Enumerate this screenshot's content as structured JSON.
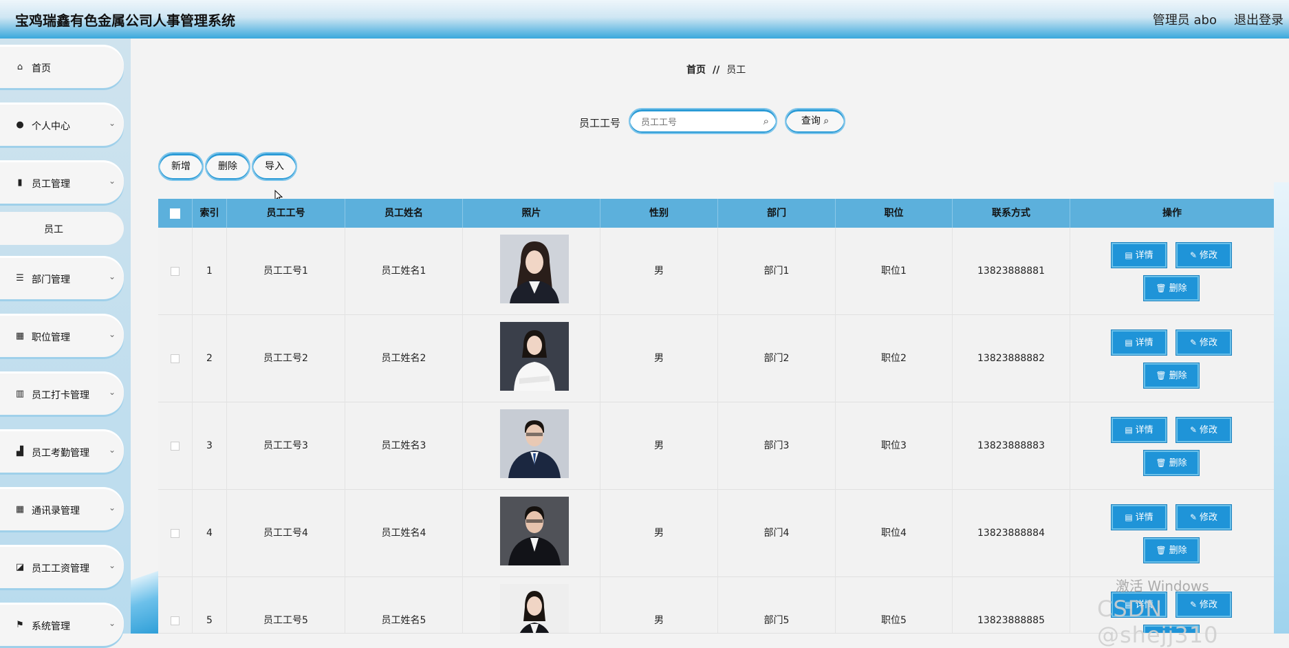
{
  "header": {
    "title": "宝鸡瑞鑫有色金属公司人事管理系统",
    "admin_label": "管理员 abo",
    "logout_label": "退出登录"
  },
  "sidebar": {
    "items": [
      {
        "label": "首页",
        "icon": "home-icon",
        "has_chevron": false
      },
      {
        "label": "个人中心",
        "icon": "user-icon",
        "has_chevron": true
      },
      {
        "label": "员工管理",
        "icon": "clipboard-icon",
        "has_chevron": true
      },
      {
        "label": "部门管理",
        "icon": "list-icon",
        "has_chevron": true
      },
      {
        "label": "职位管理",
        "icon": "grid-icon",
        "has_chevron": true
      },
      {
        "label": "员工打卡管理",
        "icon": "books-icon",
        "has_chevron": true
      },
      {
        "label": "员工考勤管理",
        "icon": "bar-chart-icon",
        "has_chevron": true
      },
      {
        "label": "通讯录管理",
        "icon": "grid-icon",
        "has_chevron": true
      },
      {
        "label": "员工工资管理",
        "icon": "line-chart-icon",
        "has_chevron": true
      },
      {
        "label": "系统管理",
        "icon": "flag-icon",
        "has_chevron": true
      }
    ],
    "sub_item": "员工"
  },
  "breadcrumb": {
    "home": "首页",
    "separator": "//",
    "current": "员工"
  },
  "search": {
    "label": "员工工号",
    "placeholder": "员工工号",
    "value": "",
    "button_label": "查询"
  },
  "toolbar": {
    "add_label": "新增",
    "delete_label": "删除",
    "import_label": "导入"
  },
  "table": {
    "headers": [
      "索引",
      "员工工号",
      "员工姓名",
      "照片",
      "性别",
      "部门",
      "职位",
      "联系方式",
      "操作"
    ],
    "rows": [
      {
        "index": "1",
        "emp_no": "员工工号1",
        "name": "员工姓名1",
        "gender": "男",
        "dept": "部门1",
        "position": "职位1",
        "phone": "13823888881"
      },
      {
        "index": "2",
        "emp_no": "员工工号2",
        "name": "员工姓名2",
        "gender": "男",
        "dept": "部门2",
        "position": "职位2",
        "phone": "13823888882"
      },
      {
        "index": "3",
        "emp_no": "员工工号3",
        "name": "员工姓名3",
        "gender": "男",
        "dept": "部门3",
        "position": "职位3",
        "phone": "13823888883"
      },
      {
        "index": "4",
        "emp_no": "员工工号4",
        "name": "员工姓名4",
        "gender": "男",
        "dept": "部门4",
        "position": "职位4",
        "phone": "13823888884"
      },
      {
        "index": "5",
        "emp_no": "员工工号5",
        "name": "员工姓名5",
        "gender": "男",
        "dept": "部门5",
        "position": "职位5",
        "phone": "13823888885"
      }
    ],
    "actions": {
      "detail": "详情",
      "edit": "修改",
      "delete": "删除"
    }
  },
  "watermark": {
    "line1": "激活 Windows",
    "line2": "CSDN @shejj310"
  },
  "colors": {
    "accent": "#1f94d8",
    "header_row": "#5cb0dc",
    "border_accent": "#2b9bd6"
  }
}
